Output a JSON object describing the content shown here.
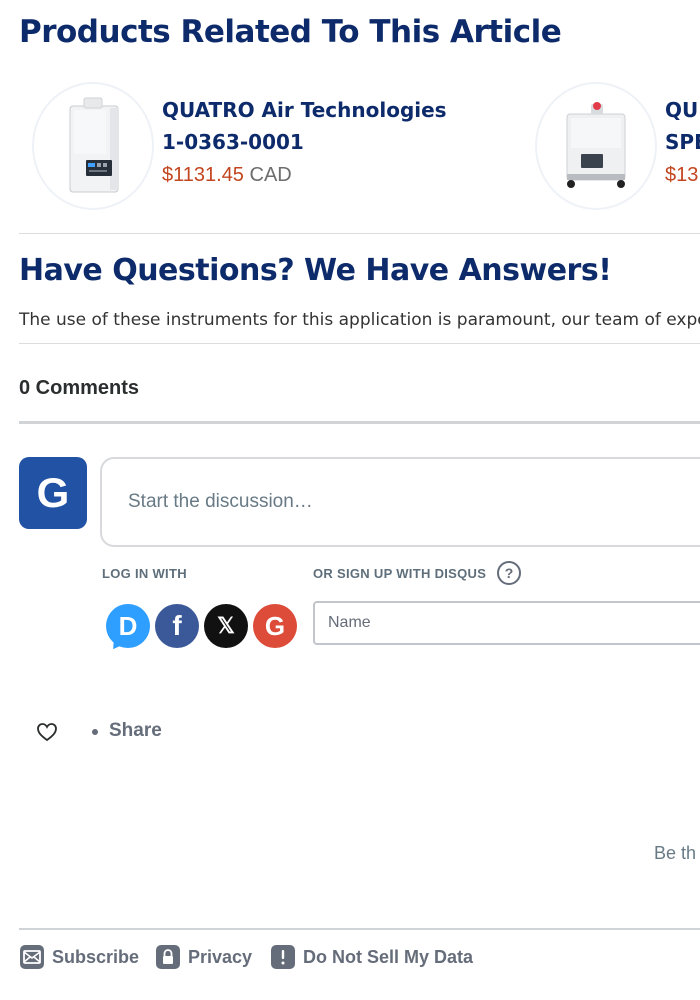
{
  "related": {
    "title": "Products Related To This Article",
    "products": [
      {
        "name_line1": "QUATRO Air Technologies",
        "name_line2": "1-0363-0001",
        "price": "$1131.45",
        "currency": "CAD",
        "thumb_icon": "fume-extractor-cabinet-image"
      },
      {
        "name_line1": "QU",
        "name_line2": "SPE",
        "price": "$13",
        "currency": "",
        "thumb_icon": "fume-extractor-cart-image"
      }
    ]
  },
  "qa": {
    "title": "Have Questions? We Have Answers!",
    "text": "The use of these instruments for this application is paramount, our team of expe"
  },
  "comments": {
    "count_label": "0 Comments",
    "avatar_letter": "G",
    "placeholder": "Start the discussion…",
    "login_label": "LOG IN WITH",
    "signup_label": "OR SIGN UP WITH DISQUS",
    "help_symbol": "?",
    "social": {
      "disqus": "D",
      "facebook": "f",
      "x": "𝕏",
      "google": "G"
    },
    "name_placeholder": "Name",
    "share_label": "Share",
    "empty_text": "Be th"
  },
  "footer": {
    "subscribe": "Subscribe",
    "privacy": "Privacy",
    "do_not_sell": "Do Not Sell My Data"
  },
  "colors": {
    "heading": "#0d2a6b",
    "price": "#c2461f",
    "avatar": "#2252a3",
    "muted": "#656c7a"
  }
}
